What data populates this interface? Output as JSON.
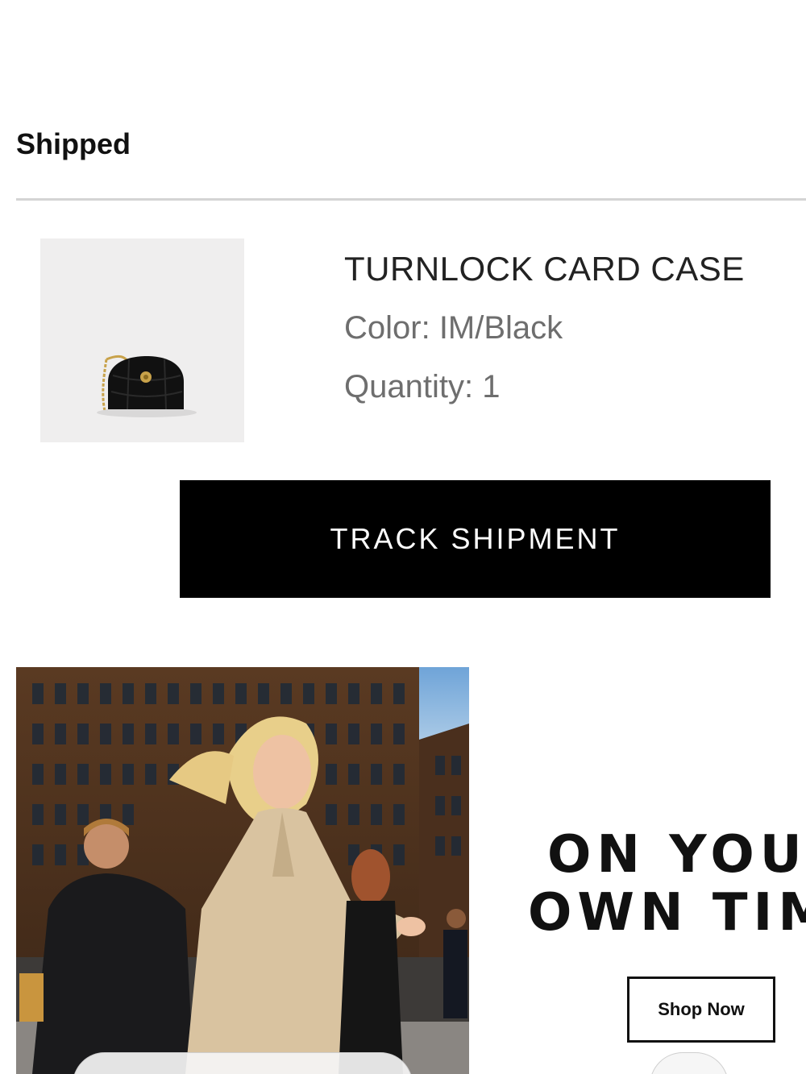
{
  "order": {
    "status_heading": "Shipped"
  },
  "product": {
    "name": "TURNLOCK CARD CASE",
    "color_text": "Color: IM/Black",
    "quantity_text": "Quantity: 1",
    "thumbnail_icon": "quilted-black-bag-image"
  },
  "actions": {
    "track_label": "TRACK SHIPMENT"
  },
  "promo": {
    "image_icon": "street-fashion-photo",
    "headline_line1": "ON YOU",
    "headline_line2": "OWN TIM",
    "shop_label": "Shop Now"
  },
  "colors": {
    "button_bg": "#000000",
    "button_text": "#ffffff",
    "divider": "#d4d4d4",
    "muted_text": "#6e6e6e"
  }
}
